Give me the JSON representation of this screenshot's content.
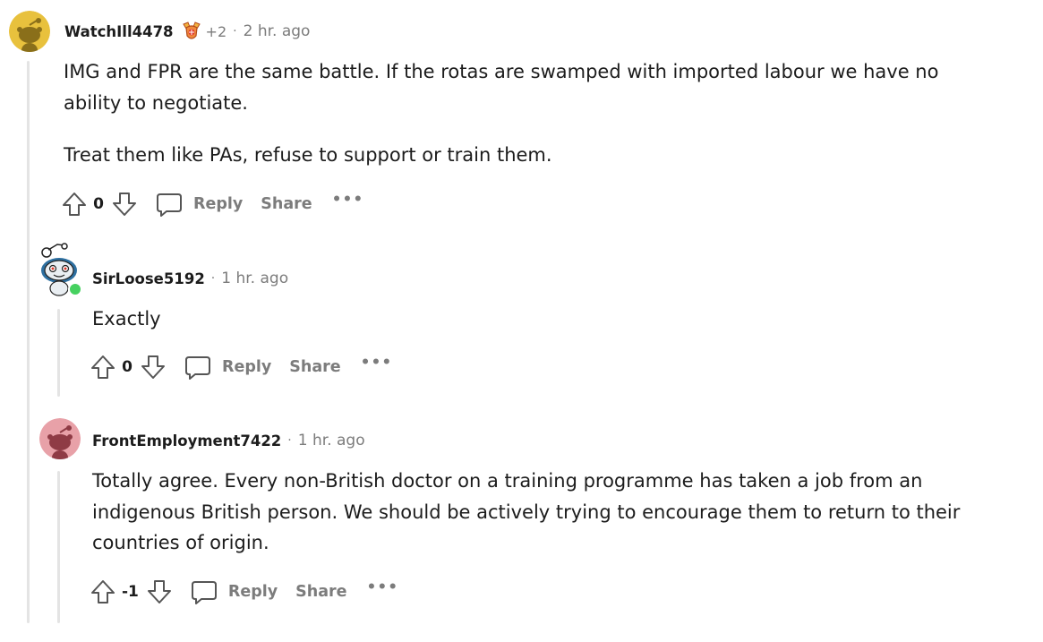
{
  "comments": [
    {
      "username": "WatchIll4478",
      "flair_count": "+2",
      "time": "2 hr. ago",
      "paragraphs": [
        [
          "IMG and FPR are the same battle. If the rotas are swamped with imported labour we have no",
          "ability to negotiate."
        ],
        [
          "Treat them like PAs, refuse to support or train them."
        ]
      ],
      "score": "0",
      "reply_label": "Reply",
      "share_label": "Share",
      "more_label": "•••",
      "avatar_color": "#e8c13d"
    },
    {
      "username": "SirLoose5192",
      "time": "1 hr. ago",
      "paragraphs": [
        [
          "Exactly"
        ]
      ],
      "score": "0",
      "reply_label": "Reply",
      "share_label": "Share",
      "more_label": "•••",
      "online_color": "#46d160"
    },
    {
      "username": "FrontEmployment7422",
      "time": "1 hr. ago",
      "paragraphs": [
        [
          "Totally agree. Every non-British doctor on a training programme has taken a job from an",
          "indigenous British person. We should be actively trying to encourage them to return to their",
          "countries of origin."
        ]
      ],
      "score": "-1",
      "reply_label": "Reply",
      "share_label": "Share",
      "more_label": "•••",
      "avatar_color": "#e8a1a8"
    }
  ],
  "separator": "·",
  "colors": {
    "meta_gray": "#7c7c7c",
    "thread_line": "#e4e4e4",
    "text": "#1c1c1c"
  }
}
